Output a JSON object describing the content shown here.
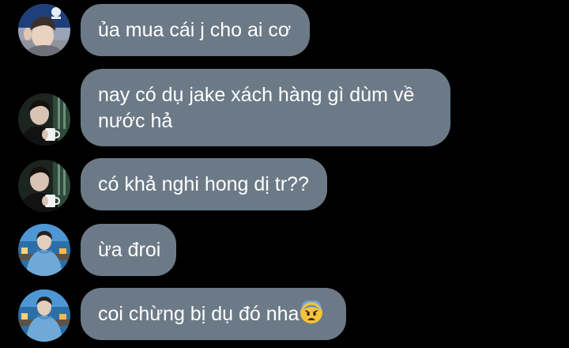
{
  "conversation": {
    "messages": [
      {
        "sender_avatar": "avatar-boy-selfie-blue",
        "text": "ủa mua cái j cho ai cơ"
      },
      {
        "sender_avatar": "avatar-man-cup-dark",
        "text_lines": [
          "nay có dụ jake xách hàng gì dùm về",
          "nước hả"
        ]
      },
      {
        "sender_avatar": "avatar-man-cup-dark",
        "text": "có khả nghi hong dị tr??"
      },
      {
        "sender_avatar": "avatar-man-blue-hoodie",
        "text": "ừa đroi"
      },
      {
        "sender_avatar": "avatar-man-blue-hoodie",
        "text": "coi chừng bị dụ đó nha",
        "trailing_emoji": "anxious-face-with-sweat-emoji"
      }
    ]
  },
  "colors": {
    "background": "#000000",
    "bubble": "#6c7a87",
    "text": "#ffffff"
  }
}
